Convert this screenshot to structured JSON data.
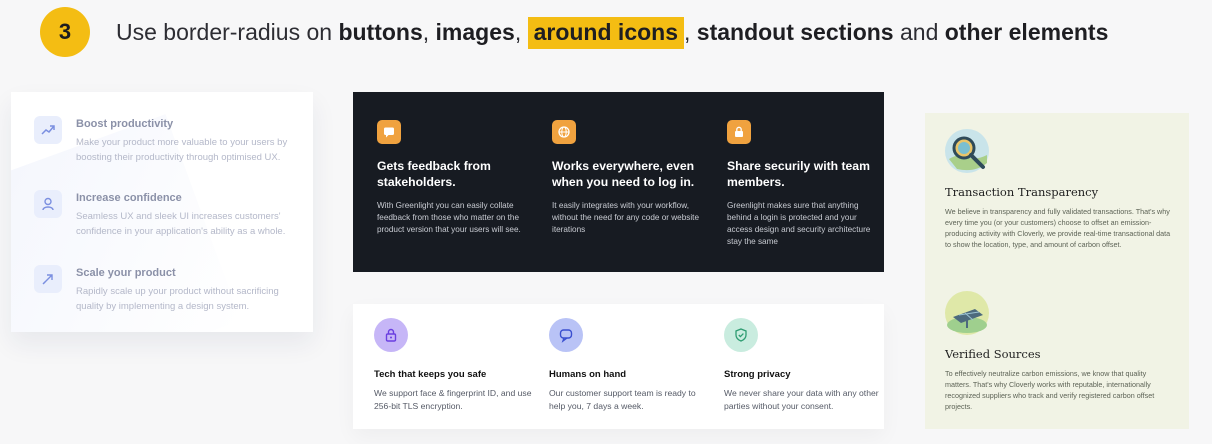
{
  "header": {
    "number": "3",
    "p1": "Use border-radius on ",
    "b1": "buttons",
    "p2": ", ",
    "b2": "images",
    "p3": ", ",
    "b3": "around icons",
    "p4": ", ",
    "b4": "standout sections",
    "p5": " and ",
    "b5": "other elements"
  },
  "card_light": {
    "features": [
      {
        "icon": "trend-up-icon",
        "title": "Boost productivity",
        "desc": "Make your product more valuable to your users by boosting their productivity through optimised UX."
      },
      {
        "icon": "user-icon",
        "title": "Increase confidence",
        "desc": "Seamless UX and sleek UI increases customers' confidence in your application's ability as a whole."
      },
      {
        "icon": "rocket-icon",
        "title": "Scale your product",
        "desc": "Rapidly scale up your product without sacrificing quality by implementing a design system."
      }
    ]
  },
  "card_dark": {
    "features": [
      {
        "icon": "chat-bubble-icon",
        "title": "Gets feedback from stakeholders.",
        "desc": "With Greenlight you can easily collate feedback from those who matter on the product version that your users will see."
      },
      {
        "icon": "globe-icon",
        "title": "Works everywhere, even when you need to log in.",
        "desc": "It easily integrates with your workflow, without the need for any code or website iterations"
      },
      {
        "icon": "lock-icon",
        "title": "Share securily with team members.",
        "desc": "Greenlight makes sure that anything behind a login is protected and your access design and security architecture stay the same"
      }
    ]
  },
  "card_white": {
    "features": [
      {
        "icon": "lock-icon",
        "color": "#c6b6f7",
        "title": "Tech that keeps you safe",
        "desc": "We support face & fingerprint ID, and use 256-bit TLS encryption."
      },
      {
        "icon": "chat-icon",
        "color": "#b9c3f6",
        "title": "Humans on hand",
        "desc": "Our customer support team is ready to help you, 7 days a week."
      },
      {
        "icon": "shield-check-icon",
        "color": "#c9ecdf",
        "title": "Strong privacy",
        "desc": "We never share your data with any other parties without your consent."
      }
    ]
  },
  "card_beige": {
    "features": [
      {
        "icon": "magnifier-illustration",
        "title": "Transaction Transparency",
        "desc": "We believe in transparency and fully validated transactions. That's why every time you (or your customers) choose to offset an emission-producing activity with Cloverly, we provide real-time transactional data to show the location, type, and amount of carbon offset."
      },
      {
        "icon": "solar-panel-illustration",
        "title": "Verified Sources",
        "desc": "To effectively neutralize carbon emissions, we know that quality matters. That's why Cloverly works with reputable, internationally recognized suppliers who track and verify registered carbon offset projects."
      }
    ]
  },
  "colors": {
    "accent": "#f4bd13",
    "dark_card": "#171b22",
    "orange_icon": "#f0a23f",
    "beige_card": "#f1f3e5"
  }
}
